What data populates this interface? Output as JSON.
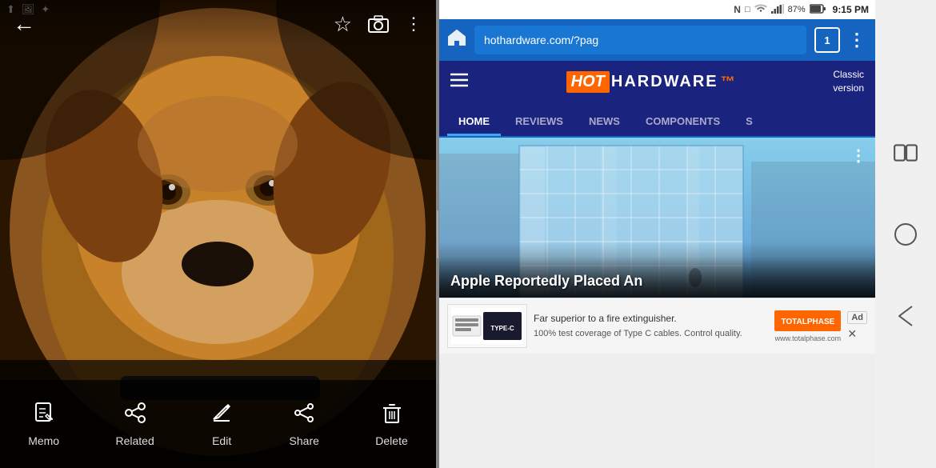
{
  "left_panel": {
    "top_bar": {
      "back_label": "←",
      "star_label": "☆",
      "camera_label": "📷",
      "more_label": "⋮"
    },
    "bottom_actions": [
      {
        "id": "memo",
        "label": "Memo",
        "icon": "✏"
      },
      {
        "id": "related",
        "label": "Related",
        "icon": "🔗"
      },
      {
        "id": "edit",
        "label": "Edit",
        "icon": "✒"
      },
      {
        "id": "share",
        "label": "Share",
        "icon": "⋈"
      },
      {
        "id": "delete",
        "label": "Delete",
        "icon": "🗑"
      }
    ],
    "android_status": {
      "icons": [
        "USB",
        "IMG",
        "✦"
      ]
    }
  },
  "right_panel": {
    "status_bar": {
      "time": "9:15 PM",
      "battery": "87%",
      "signal_icons": [
        "N",
        "📶",
        "▲",
        "87%",
        "🔋"
      ]
    },
    "url_bar": {
      "url": "hothardware.com/?pag",
      "tab_count": "1"
    },
    "hh_header": {
      "hot_text": "HOT",
      "hardware_text": "HARDWARE",
      "classic_label": "Classic\nversion"
    },
    "nav_tabs": [
      {
        "id": "home",
        "label": "HOME",
        "active": true
      },
      {
        "id": "reviews",
        "label": "REVIEWS",
        "active": false
      },
      {
        "id": "news",
        "label": "NEWS",
        "active": false
      },
      {
        "id": "components",
        "label": "COMPONENTS",
        "active": false
      },
      {
        "id": "more",
        "label": "S",
        "active": false
      }
    ],
    "article": {
      "title": "Apple Reportedly Placed An",
      "three_dots": "⋮"
    },
    "ad": {
      "text1": "Far superior to a fire extinguisher.",
      "text2": "100% test coverage of Type C cables. Control quality.",
      "brand": "TOTALPHASE",
      "brand_url": "www.totalphase.com",
      "close_label": "✕",
      "ad_label": "Ad"
    }
  },
  "right_nav": {
    "tabs_btn": "tabs",
    "home_btn": "home",
    "back_btn": "back"
  }
}
